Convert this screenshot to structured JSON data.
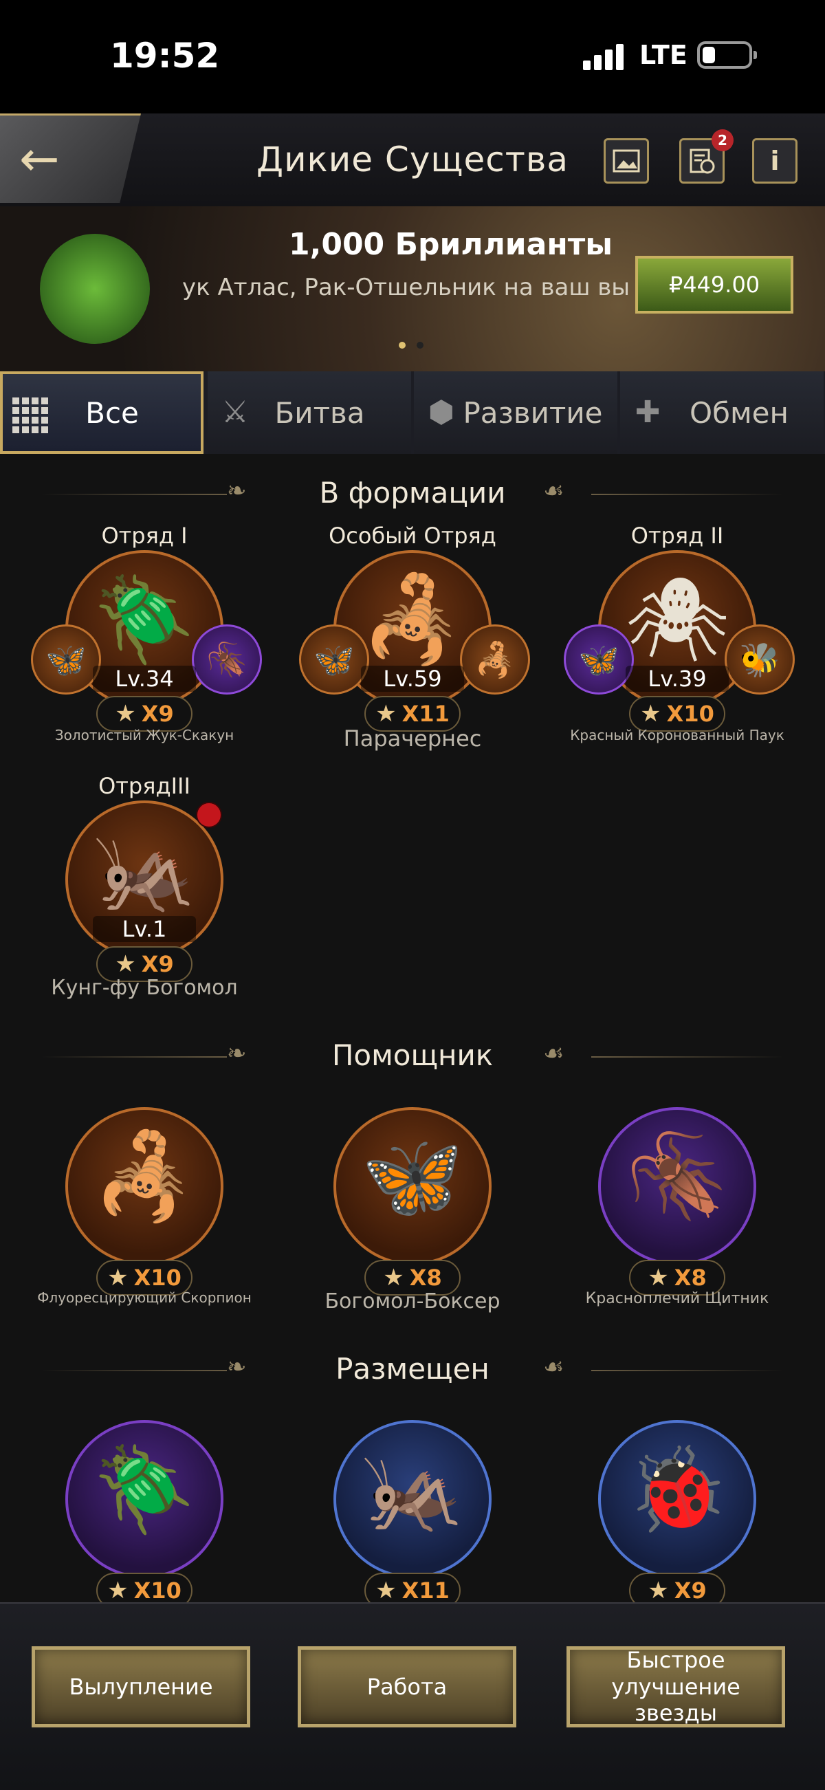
{
  "status_bar": {
    "time": "19:52",
    "network": "LTE"
  },
  "header": {
    "title": "Дикие Существа",
    "history_badge": "2",
    "info_label": "i"
  },
  "banner": {
    "title": "1,000 Бриллианты",
    "subtitle": "ук Атлас, Рак-Отшельник на ваш выбо",
    "price": "₽449.00",
    "page_count": 2,
    "active_page": 1
  },
  "tabs": [
    {
      "label": "Все",
      "active": true
    },
    {
      "label": "Битва",
      "active": false
    },
    {
      "label": "Развитие",
      "active": false
    },
    {
      "label": "Обмен",
      "active": false
    }
  ],
  "sections": {
    "formation": "В формации",
    "helper": "Помощник",
    "placed": "Размещен"
  },
  "formation": [
    {
      "squad": "Отряд I",
      "level": "Lv.34",
      "stars": "X9",
      "name": "Золотистый Жук-Скакун",
      "ring": "orange"
    },
    {
      "squad": "Особый Отряд",
      "level": "Lv.59",
      "stars": "X11",
      "name": "Парачернес",
      "ring": "orange"
    },
    {
      "squad": "Отряд II",
      "level": "Lv.39",
      "stars": "X10",
      "name": "Красный Коронованный Паук",
      "ring": "orange"
    },
    {
      "squad": "ОтрядIII",
      "level": "Lv.1",
      "stars": "X9",
      "name": "Кунг-фу Богомол",
      "ring": "orange"
    }
  ],
  "helpers": [
    {
      "stars": "X10",
      "name": "Флуоресцирующий Скорпион",
      "ring": "orange"
    },
    {
      "stars": "X8",
      "name": "Богомол-Боксер",
      "ring": "orange"
    },
    {
      "stars": "X8",
      "name": "Красноплечий Щитник",
      "ring": "purple"
    }
  ],
  "placed": [
    {
      "stars": "X10",
      "ring": "purple"
    },
    {
      "stars": "X11",
      "ring": "blue"
    },
    {
      "stars": "X9",
      "ring": "blue"
    }
  ],
  "bottom_buttons": {
    "hatch": "Вылупление",
    "work": "Работа",
    "quick_upgrade": "Быстрое улучшение звезды"
  },
  "colors": {
    "accent_gold": "#c8a960",
    "star_orange": "#f29a3c",
    "badge_red": "#b8252a"
  }
}
